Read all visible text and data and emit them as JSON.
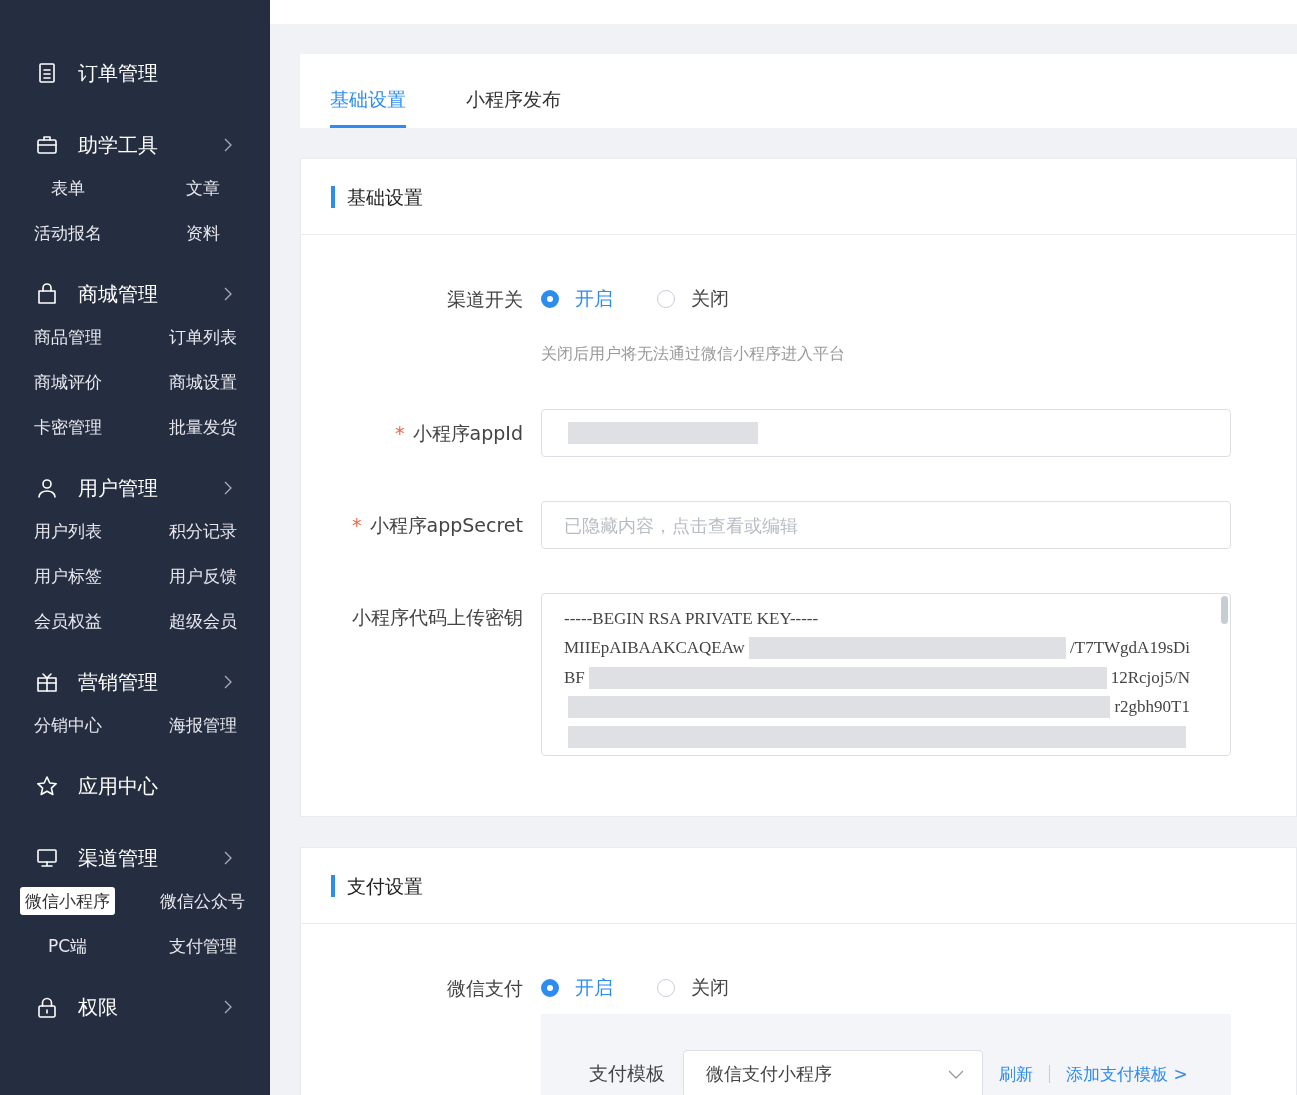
{
  "sidebar": {
    "groups": [
      {
        "label": "订单管理",
        "expandable": false
      },
      {
        "label": "助学工具",
        "expandable": true,
        "items": [
          {
            "label": "表单",
            "selected": false
          },
          {
            "label": "文章",
            "selected": false
          },
          {
            "label": "活动报名",
            "selected": false
          },
          {
            "label": "资料",
            "selected": false
          }
        ]
      },
      {
        "label": "商城管理",
        "expandable": true,
        "items": [
          {
            "label": "商品管理",
            "selected": false
          },
          {
            "label": "订单列表",
            "selected": false
          },
          {
            "label": "商城评价",
            "selected": false
          },
          {
            "label": "商城设置",
            "selected": false
          },
          {
            "label": "卡密管理",
            "selected": false
          },
          {
            "label": "批量发货",
            "selected": false
          }
        ]
      },
      {
        "label": "用户管理",
        "expandable": true,
        "items": [
          {
            "label": "用户列表",
            "selected": false
          },
          {
            "label": "积分记录",
            "selected": false
          },
          {
            "label": "用户标签",
            "selected": false
          },
          {
            "label": "用户反馈",
            "selected": false
          },
          {
            "label": "会员权益",
            "selected": false
          },
          {
            "label": "超级会员",
            "selected": false
          }
        ]
      },
      {
        "label": "营销管理",
        "expandable": true,
        "items": [
          {
            "label": "分销中心",
            "selected": false
          },
          {
            "label": "海报管理",
            "selected": false
          }
        ]
      },
      {
        "label": "应用中心",
        "expandable": false
      },
      {
        "label": "渠道管理",
        "expandable": true,
        "items": [
          {
            "label": "微信小程序",
            "selected": true
          },
          {
            "label": "微信公众号",
            "selected": false
          },
          {
            "label": "PC端",
            "selected": false
          },
          {
            "label": "支付管理",
            "selected": false
          }
        ]
      },
      {
        "label": "权限",
        "expandable": true
      }
    ]
  },
  "tabs": [
    {
      "label": "基础设置",
      "selected": true
    },
    {
      "label": "小程序发布",
      "selected": false
    }
  ],
  "basic": {
    "title": "基础设置",
    "channel_switch": {
      "label": "渠道开关",
      "options": [
        {
          "label": "开启",
          "selected": true
        },
        {
          "label": "关闭",
          "selected": false
        }
      ],
      "hint": "关闭后用户将无法通过微信小程序进入平台"
    },
    "appid": {
      "label": "小程序appId",
      "required_mark": "*"
    },
    "app_secret": {
      "label": "小程序appSecret",
      "required_mark": "*",
      "placeholder": "已隐藏内容，点击查看或编辑"
    },
    "upload_key": {
      "label": "小程序代码上传密钥",
      "lines": [
        {
          "start": "-----BEGIN RSA PRIVATE KEY-----"
        },
        {
          "start": "MIIEpAIBAAKCAQEAw",
          "end": "/T7TWgdA19sDi"
        },
        {
          "start": "BF",
          "end": "12Rcjoj5/N"
        },
        {
          "end": "r2gbh90T1"
        }
      ]
    }
  },
  "payment": {
    "title": "支付设置",
    "wechat_pay": {
      "label": "微信支付",
      "options": [
        {
          "label": "开启",
          "selected": true
        },
        {
          "label": "关闭",
          "selected": false
        }
      ]
    },
    "template": {
      "label": "支付模板",
      "value": "微信支付小程序",
      "links": [
        "刷新",
        "添加支付模板 >"
      ]
    }
  }
}
